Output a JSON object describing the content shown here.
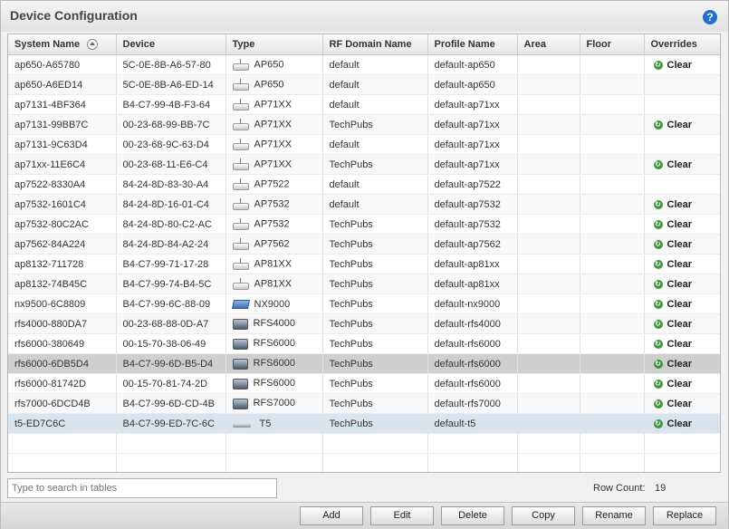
{
  "window": {
    "title": "Device Configuration",
    "help_icon": "help-icon"
  },
  "table": {
    "columns": [
      "System Name",
      "Device",
      "Type",
      "RF Domain Name",
      "Profile Name",
      "Area",
      "Floor",
      "Overrides"
    ],
    "clear_label": "Clear",
    "rows": [
      {
        "name": "ap650-A65780",
        "device": "5C-0E-8B-A6-57-80",
        "icon": "ap-icon",
        "type": "AP650",
        "rf": "default",
        "profile": "default-ap650",
        "area": "",
        "floor": "",
        "clear": true
      },
      {
        "name": "ap650-A6ED14",
        "device": "5C-0E-8B-A6-ED-14",
        "icon": "ap-icon",
        "type": "AP650",
        "rf": "default",
        "profile": "default-ap650",
        "area": "",
        "floor": "",
        "clear": false
      },
      {
        "name": "ap7131-4BF364",
        "device": "B4-C7-99-4B-F3-64",
        "icon": "ap-icon",
        "type": "AP71XX",
        "rf": "default",
        "profile": "default-ap71xx",
        "area": "",
        "floor": "",
        "clear": false
      },
      {
        "name": "ap7131-99BB7C",
        "device": "00-23-68-99-BB-7C",
        "icon": "ap-icon",
        "type": "AP71XX",
        "rf": "TechPubs",
        "profile": "default-ap71xx",
        "area": "",
        "floor": "",
        "clear": true
      },
      {
        "name": "ap7131-9C63D4",
        "device": "00-23-68-9C-63-D4",
        "icon": "ap-icon",
        "type": "AP71XX",
        "rf": "default",
        "profile": "default-ap71xx",
        "area": "",
        "floor": "",
        "clear": false
      },
      {
        "name": "ap71xx-11E6C4",
        "device": "00-23-68-11-E6-C4",
        "icon": "ap-icon",
        "type": "AP71XX",
        "rf": "TechPubs",
        "profile": "default-ap71xx",
        "area": "",
        "floor": "",
        "clear": true
      },
      {
        "name": "ap7522-8330A4",
        "device": "84-24-8D-83-30-A4",
        "icon": "ap-icon",
        "type": "AP7522",
        "rf": "default",
        "profile": "default-ap7522",
        "area": "",
        "floor": "",
        "clear": false
      },
      {
        "name": "ap7532-1601C4",
        "device": "84-24-8D-16-01-C4",
        "icon": "ap-icon",
        "type": "AP7532",
        "rf": "default",
        "profile": "default-ap7532",
        "area": "",
        "floor": "",
        "clear": true
      },
      {
        "name": "ap7532-80C2AC",
        "device": "84-24-8D-80-C2-AC",
        "icon": "ap-icon",
        "type": "AP7532",
        "rf": "TechPubs",
        "profile": "default-ap7532",
        "area": "",
        "floor": "",
        "clear": true
      },
      {
        "name": "ap7562-84A224",
        "device": "84-24-8D-84-A2-24",
        "icon": "ap-icon",
        "type": "AP7562",
        "rf": "TechPubs",
        "profile": "default-ap7562",
        "area": "",
        "floor": "",
        "clear": true
      },
      {
        "name": "ap8132-711728",
        "device": "B4-C7-99-71-17-28",
        "icon": "ap-icon",
        "type": "AP81XX",
        "rf": "TechPubs",
        "profile": "default-ap81xx",
        "area": "",
        "floor": "",
        "clear": true
      },
      {
        "name": "ap8132-74B45C",
        "device": "B4-C7-99-74-B4-5C",
        "icon": "ap-icon",
        "type": "AP81XX",
        "rf": "TechPubs",
        "profile": "default-ap81xx",
        "area": "",
        "floor": "",
        "clear": true
      },
      {
        "name": "nx9500-6C8809",
        "device": "B4-C7-99-6C-88-09",
        "icon": "nx-icon",
        "type": "NX9000",
        "rf": "TechPubs",
        "profile": "default-nx9000",
        "area": "",
        "floor": "",
        "clear": true
      },
      {
        "name": "rfs4000-880DA7",
        "device": "00-23-68-88-0D-A7",
        "icon": "rfs-icon",
        "type": "RFS4000",
        "rf": "TechPubs",
        "profile": "default-rfs4000",
        "area": "",
        "floor": "",
        "clear": true
      },
      {
        "name": "rfs6000-380649",
        "device": "00-15-70-38-06-49",
        "icon": "rfs-icon",
        "type": "RFS6000",
        "rf": "TechPubs",
        "profile": "default-rfs6000",
        "area": "",
        "floor": "",
        "clear": true
      },
      {
        "name": "rfs6000-6DB5D4",
        "device": "B4-C7-99-6D-B5-D4",
        "icon": "rfs-icon",
        "type": "RFS6000",
        "rf": "TechPubs",
        "profile": "default-rfs6000",
        "area": "",
        "floor": "",
        "clear": true
      },
      {
        "name": "rfs6000-81742D",
        "device": "00-15-70-81-74-2D",
        "icon": "rfs-icon",
        "type": "RFS6000",
        "rf": "TechPubs",
        "profile": "default-rfs6000",
        "area": "",
        "floor": "",
        "clear": true
      },
      {
        "name": "rfs7000-6DCD4B",
        "device": "B4-C7-99-6D-CD-4B",
        "icon": "rfs-icon",
        "type": "RFS7000",
        "rf": "TechPubs",
        "profile": "default-rfs7000",
        "area": "",
        "floor": "",
        "clear": true
      },
      {
        "name": "t5-ED7C6C",
        "device": "B4-C7-99-ED-7C-6C",
        "icon": "t5-icon",
        "type": "T5",
        "rf": "TechPubs",
        "profile": "default-t5",
        "area": "",
        "floor": "",
        "clear": true
      }
    ],
    "selected_row": 15,
    "hovered_row": 18
  },
  "search": {
    "placeholder": "Type to search in tables"
  },
  "row_count": {
    "label": "Row Count:",
    "value": "19"
  },
  "buttons": {
    "add": "Add",
    "edit": "Edit",
    "delete": "Delete",
    "copy": "Copy",
    "rename": "Rename",
    "replace": "Replace"
  },
  "colors": {
    "selected_row": "#cfcfcf",
    "hover_row": "#d8e4ee",
    "help_icon": "#1e6fd0",
    "clear_icon": "#3a9a3a"
  }
}
